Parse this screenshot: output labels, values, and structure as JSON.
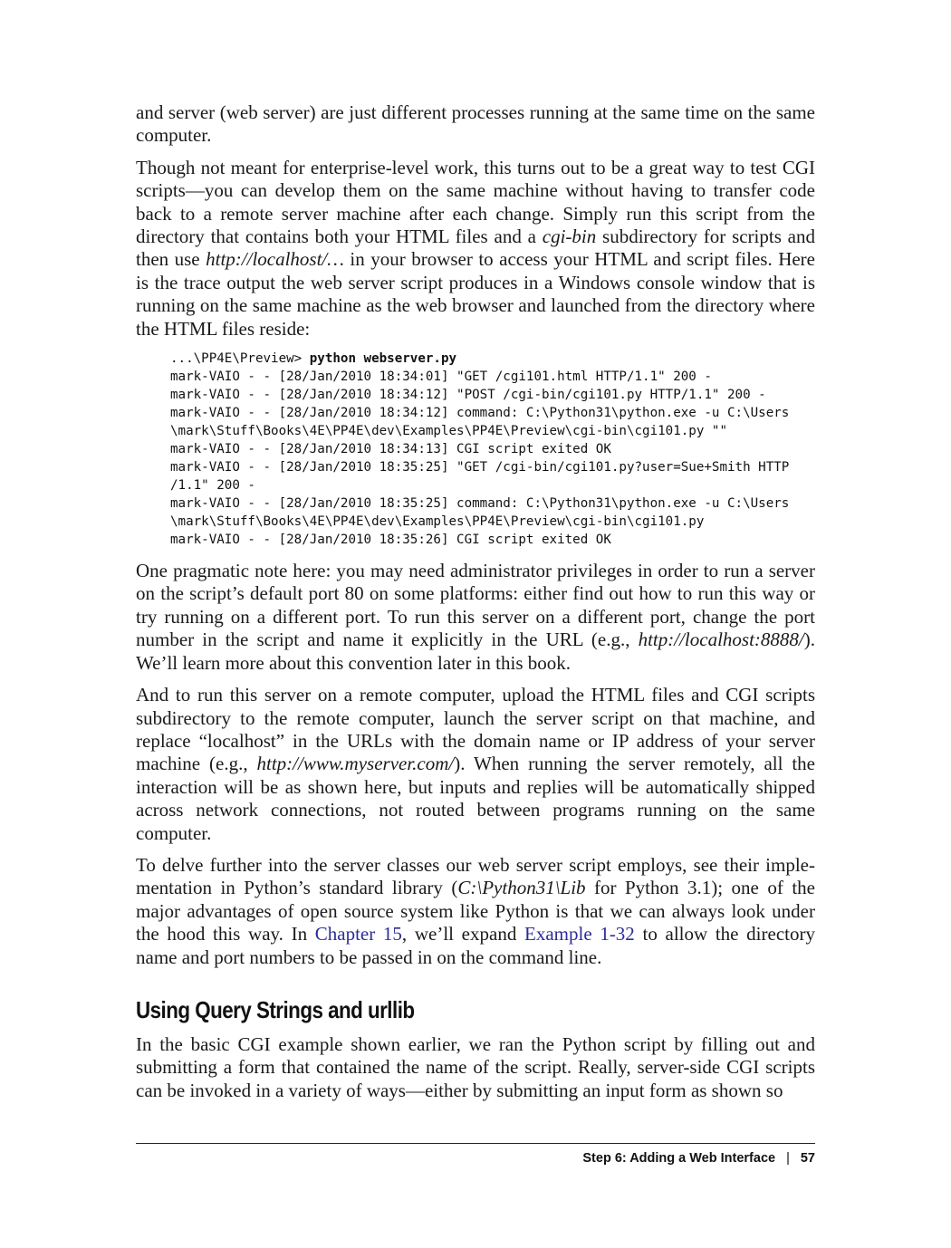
{
  "paragraphs": {
    "p1": "and server (web server) are just different processes running at the same time on the same computer.",
    "p2_a": "Though not meant for enterprise-level work, this turns out to be a great way to test CGI scripts—you can develop them on the same machine without having to transfer code back to a remote server machine after each change. Simply run this script from the directory that contains both your HTML files and a ",
    "p2_em1": "cgi-bin",
    "p2_b": " subdirectory for scripts and then use ",
    "p2_em2": "http://localhost/…",
    "p2_c": " in your browser to access your HTML and script files. Here is the trace output the web server script produces in a Windows console window that is running on the same machine as the web browser and launched from the direc­tory where the HTML files reside:",
    "p3_a": "One pragmatic note here: you may need administrator privileges in order to run a server on the script’s default port 80 on some platforms: either find out how to run this way or try running on a different port. To run this server on a different port, change the port number in the script and name it explicitly in the URL (e.g., ",
    "p3_em": "http://localhost:8888/",
    "p3_b": "). We’ll learn more about this convention later in this book.",
    "p4_a": "And to run this server on a remote computer, upload the HTML files and CGI scripts subdirectory to the remote computer, launch the server script on that machine, and replace “localhost” in the URLs with the domain name or IP address of your server machine (e.g., ",
    "p4_em": "http://www.myserver.com/",
    "p4_b": "). When running the server remotely, all the interaction will be as shown here, but inputs and replies will be automatically shipped across network connections, not routed between programs running on the same computer.",
    "p5_a": "To delve further into the server classes our web server script employs, see their imple­mentation in Python’s standard library (",
    "p5_em": "C:\\Python31\\Lib",
    "p5_b": " for Python 3.1); one of the major advantages of open source system like Python is that we can always look under the hood this way. In ",
    "p5_link1": "Chapter 15",
    "p5_c": ", we’ll expand ",
    "p5_link2": "Example 1-32",
    "p5_d": " to allow the directory name and port numbers to be passed in on the command line.",
    "p6": "In the basic CGI example shown earlier, we ran the Python script by filling out and submitting a form that contained the name of the script. Really, server-side CGI scripts can be invoked in a variety of ways—either by submitting an input form as shown so"
  },
  "code": {
    "prompt": "...\\PP4E\\Preview> ",
    "command": "python webserver.py",
    "output": "mark-VAIO - - [28/Jan/2010 18:34:01] \"GET /cgi101.html HTTP/1.1\" 200 -\nmark-VAIO - - [28/Jan/2010 18:34:12] \"POST /cgi-bin/cgi101.py HTTP/1.1\" 200 -\nmark-VAIO - - [28/Jan/2010 18:34:12] command: C:\\Python31\\python.exe -u C:\\Users\n\\mark\\Stuff\\Books\\4E\\PP4E\\dev\\Examples\\PP4E\\Preview\\cgi-bin\\cgi101.py \"\"\nmark-VAIO - - [28/Jan/2010 18:34:13] CGI script exited OK\nmark-VAIO - - [28/Jan/2010 18:35:25] \"GET /cgi-bin/cgi101.py?user=Sue+Smith HTTP\n/1.1\" 200 -\nmark-VAIO - - [28/Jan/2010 18:35:25] command: C:\\Python31\\python.exe -u C:\\Users\n\\mark\\Stuff\\Books\\4E\\PP4E\\dev\\Examples\\PP4E\\Preview\\cgi-bin\\cgi101.py\nmark-VAIO - - [28/Jan/2010 18:35:26] CGI script exited OK"
  },
  "section": {
    "heading": "Using Query Strings and urllib"
  },
  "footer": {
    "title": "Step 6: Adding a Web Interface",
    "separator": "|",
    "page_number": "57"
  },
  "colors": {
    "link": "#2b2b9c",
    "text": "#1a1a1a"
  }
}
